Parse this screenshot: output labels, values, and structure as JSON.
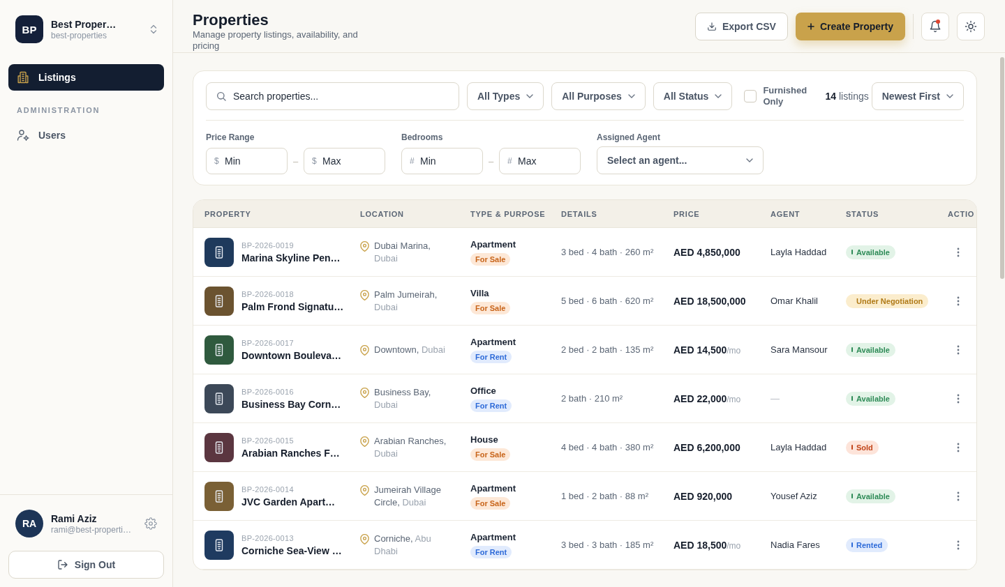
{
  "sidebar": {
    "workspace": {
      "initials": "BP",
      "name": "Best Proper…",
      "slug": "best-properties"
    },
    "nav": [
      {
        "label": "Listings",
        "selected": true
      }
    ],
    "admin": {
      "title": "ADMINISTRATION",
      "items": [
        {
          "label": "Users",
          "selected": false
        }
      ]
    },
    "user": {
      "initials": "RA",
      "name": "Rami Aziz",
      "email": "rami@best-properti…"
    },
    "sign_out": "Sign Out"
  },
  "header": {
    "title": "Properties",
    "subtitle": "Manage property listings, availability, and pricing",
    "export_button": "Export CSV",
    "create_button": "Create Property",
    "notifications_unread": true
  },
  "filters": {
    "search": {
      "placeholder": "Search properties..."
    },
    "dropdowns": [
      {
        "label": "All Types"
      },
      {
        "label": "All Purposes"
      },
      {
        "label": "All Status"
      }
    ],
    "furnished": {
      "label": "Furnished Only",
      "checked": false
    },
    "count": "**14** listings",
    "sort": {
      "label": "Newest First"
    },
    "ranges": [
      {
        "label": "Price Range",
        "min": {
          "prefix": "$",
          "placeholder": "Min"
        },
        "separator": "–",
        "max": {
          "prefix": "$",
          "placeholder": "Max"
        }
      },
      {
        "label": "Bedrooms",
        "min": {
          "prefix": "#",
          "placeholder": "Min"
        },
        "separator": "–",
        "max": {
          "prefix": "#",
          "placeholder": "Max"
        }
      }
    ],
    "agent": {
      "label": "Assigned Agent",
      "placeholder": "Select an agent..."
    }
  },
  "table": {
    "columns": [
      "PROPERTY",
      "LOCATION",
      "TYPE & PURPOSE",
      "DETAILS",
      "PRICE",
      "AGENT",
      "STATUS",
      "ACTIO"
    ],
    "rows": [
      {
        "code": "BP-2026-0019",
        "name": "Marina Skyline Pen…",
        "color": "#1f3a5c",
        "area": "Dubai Marina,",
        "city": "Dubai",
        "type": "Apartment",
        "purpose": {
          "label": "For Sale",
          "kind": "sale"
        },
        "details": "3 bed · 4 bath · 260 m²",
        "price": {
          "amount": "AED 4,850,000"
        },
        "agent": {
          "name": "Layla Haddad",
          "assigned": true
        },
        "status": {
          "label": "Available",
          "kind": "available"
        }
      },
      {
        "code": "BP-2026-0018",
        "name": "Palm Frond Signatu…",
        "color": "#6b5330",
        "area": "Palm Jumeirah,",
        "city": "Dubai",
        "type": "Villa",
        "purpose": {
          "label": "For Sale",
          "kind": "sale"
        },
        "details": "5 bed · 6 bath · 620 m²",
        "price": {
          "amount": "AED 18,500,000"
        },
        "agent": {
          "name": "Omar Khalil",
          "assigned": true
        },
        "status": {
          "label": "Under Negotiation",
          "kind": "negotiation"
        }
      },
      {
        "code": "BP-2026-0017",
        "name": "Downtown Bouleva…",
        "color": "#2f5a3e",
        "area": "Downtown,",
        "city": "Dubai",
        "type": "Apartment",
        "purpose": {
          "label": "For Rent",
          "kind": "rent"
        },
        "details": "2 bed · 2 bath · 135 m²",
        "price": {
          "amount": "AED 14,500",
          "period": "/mo"
        },
        "agent": {
          "name": "Sara Mansour",
          "assigned": true
        },
        "status": {
          "label": "Available",
          "kind": "available"
        }
      },
      {
        "code": "BP-2026-0016",
        "name": "Business Bay Corn…",
        "color": "#3c4858",
        "area": "Business Bay,",
        "city": "Dubai",
        "type": "Office",
        "purpose": {
          "label": "For Rent",
          "kind": "rent"
        },
        "details": "2 bath · 210 m²",
        "price": {
          "amount": "AED 22,000",
          "period": "/mo"
        },
        "agent": {
          "name": "—",
          "assigned": false
        },
        "status": {
          "label": "Available",
          "kind": "available"
        }
      },
      {
        "code": "BP-2026-0015",
        "name": "Arabian Ranches F…",
        "color": "#5b3640",
        "area": "Arabian Ranches,",
        "city": "Dubai",
        "type": "House",
        "purpose": {
          "label": "For Sale",
          "kind": "sale"
        },
        "details": "4 bed · 4 bath · 380 m²",
        "price": {
          "amount": "AED 6,200,000"
        },
        "agent": {
          "name": "Layla Haddad",
          "assigned": true
        },
        "status": {
          "label": "Sold",
          "kind": "sold"
        }
      },
      {
        "code": "BP-2026-0014",
        "name": "JVC Garden Apart…",
        "color": "#7a6035",
        "area": "Jumeirah Village Circle,",
        "city": "Dubai",
        "type": "Apartment",
        "purpose": {
          "label": "For Sale",
          "kind": "sale"
        },
        "details": "1 bed · 2 bath · 88 m²",
        "price": {
          "amount": "AED 920,000"
        },
        "agent": {
          "name": "Yousef Aziz",
          "assigned": true
        },
        "status": {
          "label": "Available",
          "kind": "available"
        }
      },
      {
        "code": "BP-2026-0013",
        "name": "Corniche Sea-View …",
        "color": "#1f3b60",
        "area": "Corniche,",
        "city": "Abu Dhabi",
        "type": "Apartment",
        "purpose": {
          "label": "For Rent",
          "kind": "rent"
        },
        "details": "3 bed · 3 bath · 185 m²",
        "price": {
          "amount": "AED 18,500",
          "period": "/mo"
        },
        "agent": {
          "name": "Nadia Fares",
          "assigned": true
        },
        "status": {
          "label": "Rented",
          "kind": "rented"
        }
      }
    ]
  }
}
